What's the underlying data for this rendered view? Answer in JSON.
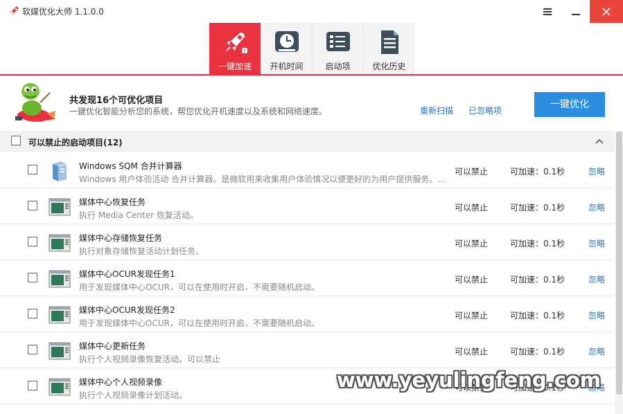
{
  "window": {
    "title": "软媒优化大师 1.1.0.0"
  },
  "tabs": [
    {
      "label": "一键加速",
      "icon": "rocket-icon",
      "active": true
    },
    {
      "label": "开机时间",
      "icon": "clock-icon",
      "active": false
    },
    {
      "label": "启动项",
      "icon": "startup-list-icon",
      "active": false
    },
    {
      "label": "优化历史",
      "icon": "history-document-icon",
      "active": false
    }
  ],
  "summary": {
    "title": "共发现16个可优化项目",
    "description": "一键优化智能分析您的系统，帮您优化开机速度以及系统和网络速度。",
    "rescan_label": "重新扫描",
    "ignored_label": "已忽略项",
    "optimize_label": "一键优化"
  },
  "section": {
    "title": "可以禁止的启动项目(12)"
  },
  "rows": [
    {
      "title": "Windows SQM 合并计算器",
      "desc": "Windows 用户体验活动 合并计算器。是微软用来收集用户体验情况以便更好的为用户提供服务。...",
      "status": "可以禁止",
      "speed": "可加速：0.1秒",
      "ignore": "忽略",
      "icon": "sqm-book-icon"
    },
    {
      "title": "媒体中心恢复任务",
      "desc": "执行 Media Center 恢复活动。",
      "status": "可以禁止",
      "speed": "可加速：0.1秒",
      "ignore": "忽略",
      "icon": "task-window-icon"
    },
    {
      "title": "媒体中心存储恢复任务",
      "desc": "执行对象存储恢复活动计划任务。",
      "status": "可以禁止",
      "speed": "可加速：0.1秒",
      "ignore": "忽略",
      "icon": "task-window-icon"
    },
    {
      "title": "媒体中心OCUR发现任务1",
      "desc": "用于发现媒体中心OCUR，可以在使用时开启，不需要随机启动。",
      "status": "可以禁止",
      "speed": "可加速：0.1秒",
      "ignore": "忽略",
      "icon": "task-window-icon"
    },
    {
      "title": "媒体中心OCUR发现任务2",
      "desc": "用于发现媒体中心OCUR，可以在使用时开启，不需要随机启动。",
      "status": "可以禁止",
      "speed": "可加速：0.1秒",
      "ignore": "忽略",
      "icon": "task-window-icon"
    },
    {
      "title": "媒体中心更新任务",
      "desc": "执行个人视频录像恢复活动。可以禁止",
      "status": "可以禁止",
      "speed": "可加速：0.1秒",
      "ignore": "忽略",
      "icon": "task-window-icon"
    },
    {
      "title": "媒体中心个人视频录像",
      "desc": "执行个人视频录像计划活动。",
      "status": "可以禁止",
      "speed": "可加速：0.1秒",
      "ignore": "忽略",
      "icon": "task-window-icon"
    }
  ],
  "watermark": "www.yeyulingfeng.com",
  "colors": {
    "accent_red": "#e8323f",
    "button_blue": "#2a8de0",
    "link_blue": "#2b73c4"
  }
}
